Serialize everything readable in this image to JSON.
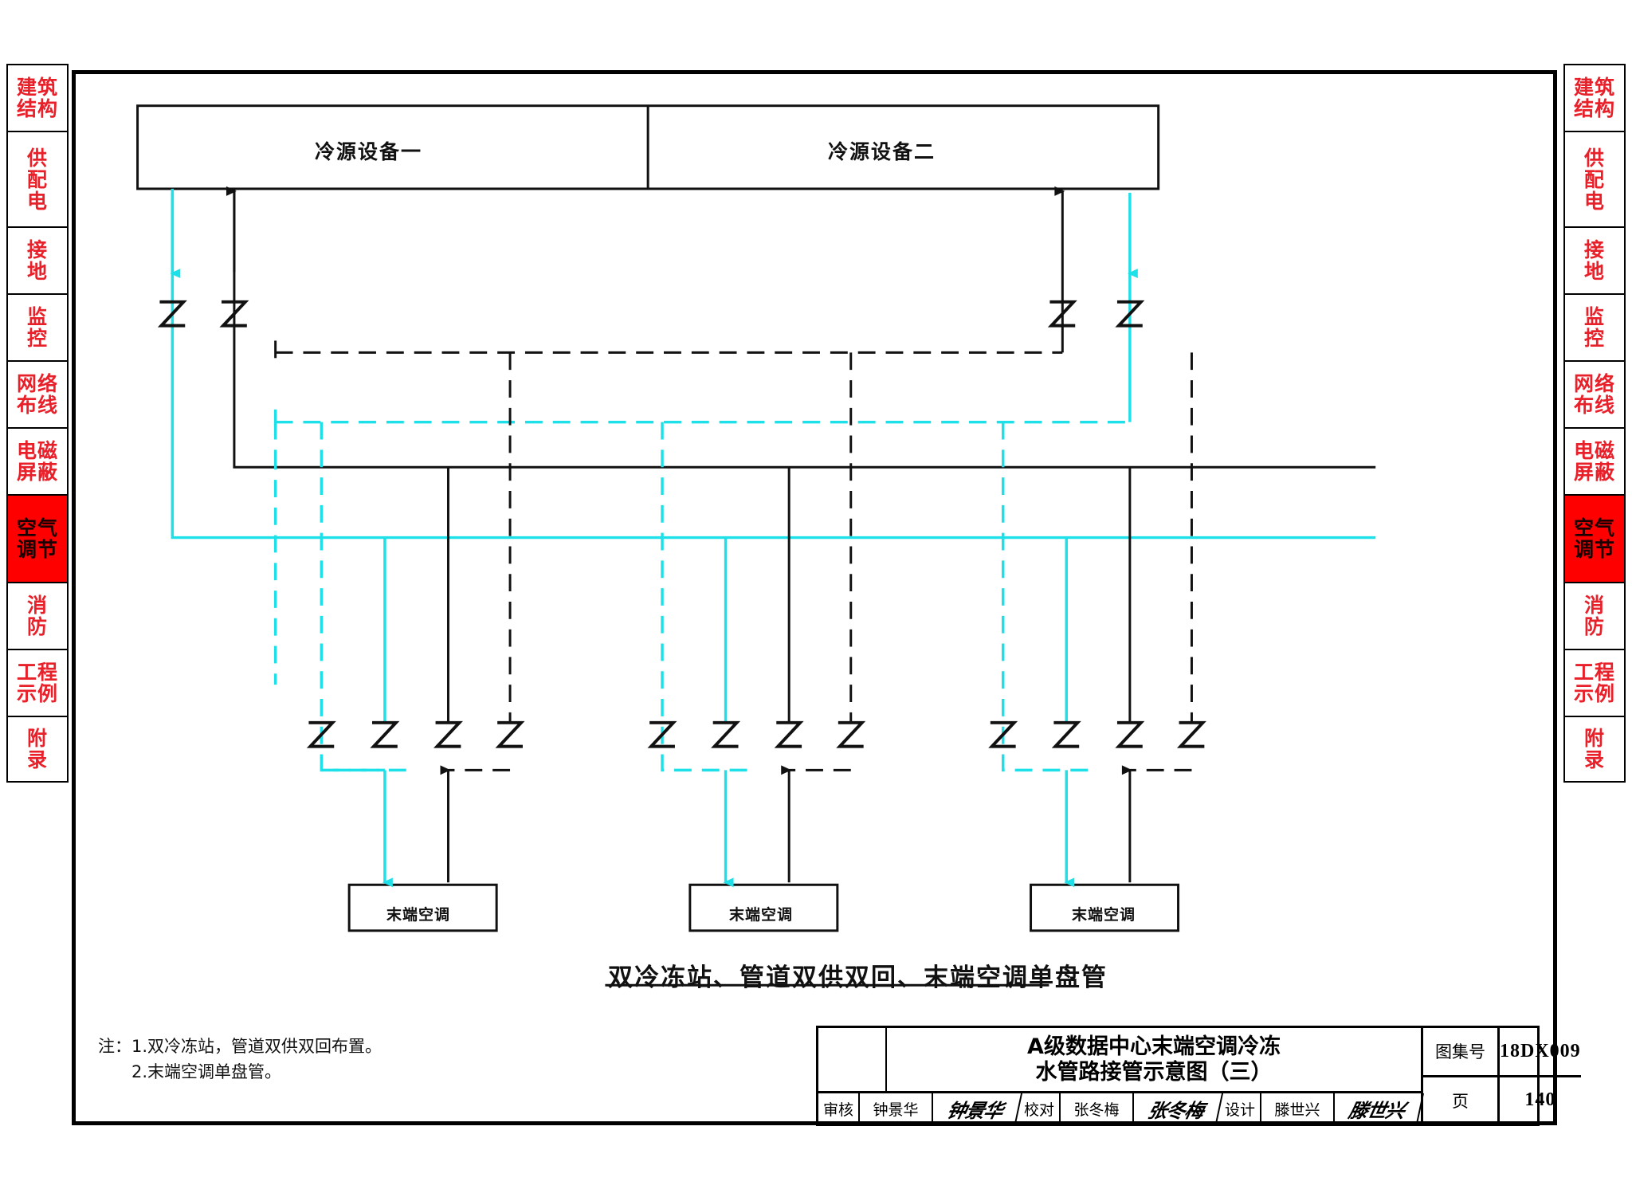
{
  "sidebar": {
    "items": [
      {
        "id": "jianzhu-jiegou",
        "lines": [
          "建筑",
          "结构"
        ],
        "active": false
      },
      {
        "id": "gongpeidian",
        "lines": [
          "供",
          "配",
          "电"
        ],
        "active": false
      },
      {
        "id": "jiedi",
        "lines": [
          "接",
          "地"
        ],
        "active": false
      },
      {
        "id": "jiankong",
        "lines": [
          "监",
          "控"
        ],
        "active": false
      },
      {
        "id": "wangluo-buxian",
        "lines": [
          "网络",
          "布线"
        ],
        "active": false
      },
      {
        "id": "diancizhibi",
        "lines": [
          "电磁",
          "屏蔽"
        ],
        "active": false
      },
      {
        "id": "kongqi-tiaojie",
        "lines": [
          "空气",
          "调节"
        ],
        "active": true
      },
      {
        "id": "xiaofang",
        "lines": [
          "消",
          "防"
        ],
        "active": false
      },
      {
        "id": "gongcheng-shili",
        "lines": [
          "工程",
          "示例"
        ],
        "active": false
      },
      {
        "id": "fulu",
        "lines": [
          "附",
          "录"
        ],
        "active": false
      }
    ]
  },
  "diagram": {
    "chiller_plants": [
      {
        "id": "plant-1",
        "label": "冷源设备一"
      },
      {
        "id": "plant-2",
        "label": "冷源设备二"
      }
    ],
    "terminal_units": [
      {
        "id": "terminal-1",
        "label": "末端空调"
      },
      {
        "id": "terminal-2",
        "label": "末端空调"
      },
      {
        "id": "terminal-3",
        "label": "末端空调"
      }
    ],
    "flex_joint_symbol": "Z",
    "riser_joint_count": 4,
    "branch_joint_count": 12,
    "colors": {
      "supply_cyan": "#1ee0e8",
      "return_black": "#111111",
      "tab_red": "#e8202a",
      "tab_active_bg": "#ff0000"
    },
    "caption": "双冷冻站、管道双供双回、末端空调单盘管"
  },
  "notes": {
    "prefix": "注：",
    "items": [
      "1.双冷冻站，管道双供双回布置。",
      "2.末端空调单盘管。"
    ]
  },
  "title_block": {
    "title_line_1": "A级数据中心末端空调冷冻",
    "title_line_2": "水管路接管示意图（三）",
    "signatures": [
      {
        "role": "审核",
        "name": "钟景华",
        "mark": "钟景华"
      },
      {
        "role": "校对",
        "name": "张冬梅",
        "mark": "张冬梅"
      },
      {
        "role": "设计",
        "name": "滕世兴",
        "mark": "滕世兴"
      }
    ],
    "atlas_key": "图集号",
    "atlas_value": "18DX009",
    "page_key": "页",
    "page_value": "140"
  }
}
